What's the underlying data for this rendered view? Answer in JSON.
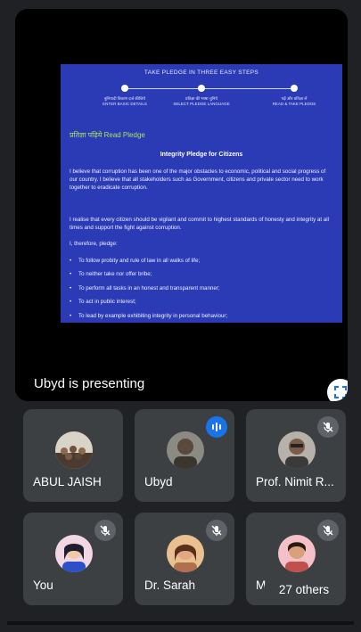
{
  "presentation": {
    "banner": "TAKE PLEDGE IN THREE EASY STEPS",
    "steps": [
      {
        "hindi": "बुनियादी विवरण दर्ज कीजिये",
        "english": "ENTER BASIC DETAILS"
      },
      {
        "hindi": "प्रतिज्ञा की भाषा चुनिये",
        "english": "SELECT PLEDGE LANGUAGE"
      },
      {
        "hindi": "पढ़ें और प्रतिज्ञा लें",
        "english": "READ & TAKE PLEDGE"
      }
    ],
    "read_pledge": "प्रतिज्ञा पढ़िये Read Pledge",
    "title": "Integrity Pledge for Citizens",
    "para1": "I believe that corruption has been one of the major obstacles to economic, political and social progress of our country. I believe that all stakeholders such as Government, citizens and private sector need to work together to eradicate corruption.",
    "para2": "I realise that every citizen should be vigilant and commit to highest standards of honesty and integrity at all times and support the fight against corruption.",
    "para3": "I, therefore, pledge:",
    "pledges": [
      "To follow probity and rule of law in all walks of life;",
      "To neither take nor offer bribe;",
      "To perform all tasks in an honest and transparent manner;",
      "To act in public interest;",
      "To lead by example exhibiting integrity in personal behaviour;"
    ],
    "status": "Ubyd is presenting"
  },
  "participants": [
    {
      "name": "ABUL JAISH",
      "state": "none",
      "avatar_color": "#8a6a4f"
    },
    {
      "name": "Ubyd",
      "state": "speaking",
      "avatar_color": "#5a4a3c"
    },
    {
      "name": "Prof. Nimit R...",
      "state": "muted",
      "avatar_color": "#7a5b4a"
    },
    {
      "name": "You",
      "state": "muted",
      "avatar_color": "#e86fa0"
    },
    {
      "name": "Dr. Sarah",
      "state": "muted",
      "avatar_color": "#b0704f"
    },
    {
      "name": "M...",
      "state": "muted",
      "avatar_color": "#c0504d"
    }
  ],
  "others_label": "27 others",
  "colors": {
    "background": "#202124",
    "tile": "#3c4043",
    "slide": "#2b3bb5",
    "accent": "#1a73e8"
  }
}
